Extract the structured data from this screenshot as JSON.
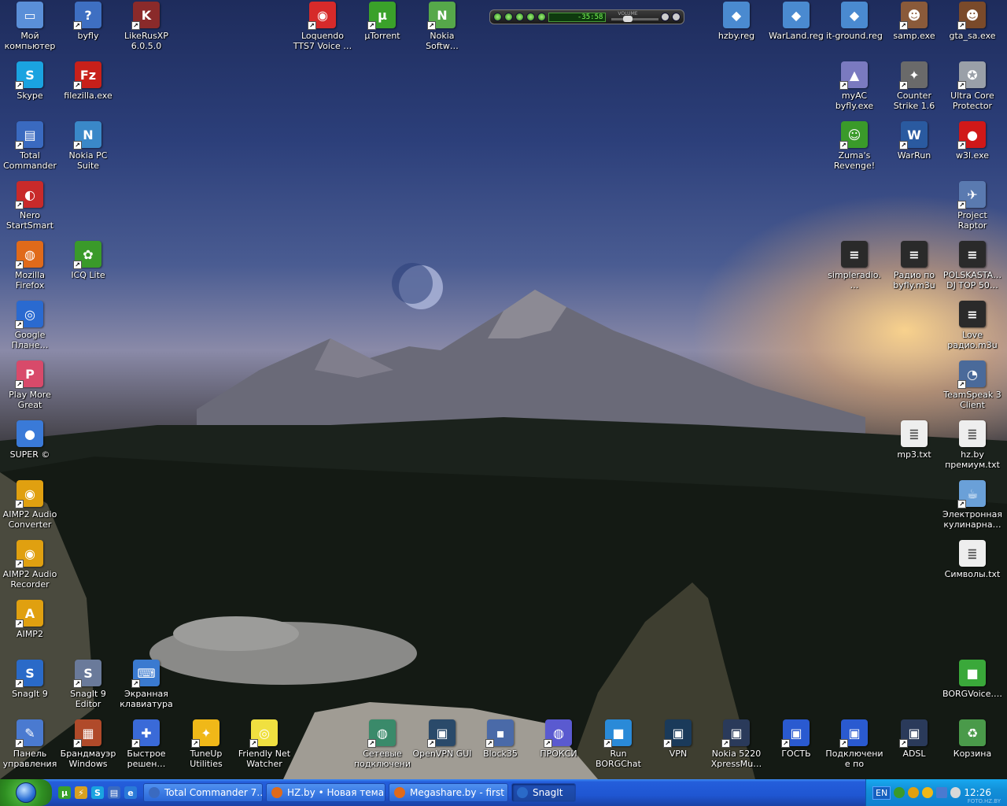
{
  "desktop_icons": [
    {
      "name": "my-computer-icon",
      "label": "Мой компьютер",
      "glyph": "▭",
      "color": "#5a8fd8",
      "shortcut": false
    },
    {
      "name": "byfly-icon",
      "label": "byfly",
      "glyph": "?",
      "color": "#3e6fc2",
      "shortcut": true
    },
    {
      "name": "likerusxp-icon",
      "label": "LikeRusXP 6.0.5.0",
      "glyph": "K",
      "color": "#8a2a2a",
      "shortcut": true
    },
    {
      "name": "loquendo-icon",
      "label": "Loquendo TTS7 Voice …",
      "glyph": "◉",
      "color": "#d62a2a",
      "shortcut": true
    },
    {
      "name": "utorrent-icon",
      "label": "µTorrent",
      "glyph": "µ",
      "color": "#3aa12a",
      "shortcut": true
    },
    {
      "name": "nokia-software-icon",
      "label": "Nokia Softw…",
      "glyph": "N",
      "color": "#56a84a",
      "shortcut": true
    },
    {
      "name": "hzby-reg-icon",
      "label": "hzby.reg",
      "glyph": "◆",
      "color": "#4a8ad0",
      "shortcut": false
    },
    {
      "name": "warland-reg-icon",
      "label": "WarLand.reg",
      "glyph": "◆",
      "color": "#4a8ad0",
      "shortcut": false
    },
    {
      "name": "it-ground-reg-icon",
      "label": "it-ground.reg",
      "glyph": "◆",
      "color": "#4a8ad0",
      "shortcut": false
    },
    {
      "name": "samp-icon",
      "label": "samp.exe",
      "glyph": "☻",
      "color": "#8a5a3a",
      "shortcut": true
    },
    {
      "name": "gta-sa-icon",
      "label": "gta_sa.exe",
      "glyph": "☻",
      "color": "#7a4a2a",
      "shortcut": true
    },
    {
      "name": "skype-icon",
      "label": "Skype",
      "glyph": "S",
      "color": "#1aa3e0",
      "shortcut": true
    },
    {
      "name": "filezilla-icon",
      "label": "filezilla.exe",
      "glyph": "Fz",
      "color": "#c8201a",
      "shortcut": true
    },
    {
      "name": "myac-icon",
      "label": "myAC byfly.exe",
      "glyph": "▲",
      "color": "#7a7ac0",
      "shortcut": true
    },
    {
      "name": "counter-strike-icon",
      "label": "Counter Strike 1.6",
      "glyph": "✦",
      "color": "#6a6a6a",
      "shortcut": true
    },
    {
      "name": "ultra-core-icon",
      "label": "Ultra Core Protector",
      "glyph": "✪",
      "color": "#9aa0a8",
      "shortcut": true
    },
    {
      "name": "total-commander-icon",
      "label": "Total Commander",
      "glyph": "▤",
      "color": "#3a6ac0",
      "shortcut": true
    },
    {
      "name": "nokia-pc-suite-icon",
      "label": "Nokia PC Suite",
      "glyph": "N",
      "color": "#3a88c8",
      "shortcut": true
    },
    {
      "name": "zuma-icon",
      "label": "Zuma's Revenge!",
      "glyph": "☺",
      "color": "#3a9a2a",
      "shortcut": true
    },
    {
      "name": "warrun-icon",
      "label": "WarRun",
      "glyph": "W",
      "color": "#2a5aa0",
      "shortcut": true
    },
    {
      "name": "w3l-icon",
      "label": "w3l.exe",
      "glyph": "●",
      "color": "#d01818",
      "shortcut": true
    },
    {
      "name": "nero-icon",
      "label": "Nero StartSmart",
      "glyph": "◐",
      "color": "#c82a2a",
      "shortcut": true
    },
    {
      "name": "project-raptor-icon",
      "label": "Project Raptor",
      "glyph": "✈",
      "color": "#5a7ab0",
      "shortcut": true
    },
    {
      "name": "firefox-icon",
      "label": "Mozilla Firefox",
      "glyph": "◍",
      "color": "#e06a1a",
      "shortcut": true
    },
    {
      "name": "icq-icon",
      "label": "ICQ Lite",
      "glyph": "✿",
      "color": "#3a9a2a",
      "shortcut": true
    },
    {
      "name": "simpleradio-icon",
      "label": "simpleradio.…",
      "glyph": "≡",
      "color": "#2a2a2a",
      "shortcut": false
    },
    {
      "name": "radio-byfly-icon",
      "label": "Радио по byfly.m3u",
      "glyph": "≡",
      "color": "#2a2a2a",
      "shortcut": false
    },
    {
      "name": "polskasta-icon",
      "label": "POLSKASTA… DJ TOP 50…",
      "glyph": "≡",
      "color": "#2a2a2a",
      "shortcut": false
    },
    {
      "name": "google-earth-icon",
      "label": "Google Плане…",
      "glyph": "◎",
      "color": "#2a6ad0",
      "shortcut": true
    },
    {
      "name": "love-radio-icon",
      "label": "Love радио.m3u",
      "glyph": "≡",
      "color": "#2a2a2a",
      "shortcut": false
    },
    {
      "name": "play-more-games-icon",
      "label": "Play More Great Games!",
      "glyph": "P",
      "color": "#d84a6a",
      "shortcut": true
    },
    {
      "name": "teamspeak-icon",
      "label": "TeamSpeak 3 Client",
      "glyph": "◔",
      "color": "#4a6a9a",
      "shortcut": true
    },
    {
      "name": "super-icon",
      "label": "SUPER ©",
      "glyph": "●",
      "color": "#3a7ad8",
      "shortcut": false
    },
    {
      "name": "mp3-txt-icon",
      "label": "mp3.txt",
      "glyph": "≣",
      "color": "#eeeeee",
      "shortcut": false
    },
    {
      "name": "hzby-premium-icon",
      "label": "hz.by премиум.txt",
      "glyph": "≣",
      "color": "#eeeeee",
      "shortcut": false
    },
    {
      "name": "aimp2-audio-converter-icon",
      "label": "AIMP2 Audio Converter",
      "glyph": "◉",
      "color": "#e0a010",
      "shortcut": true
    },
    {
      "name": "electronic-cookbook-icon",
      "label": "Электронная кулинарна…",
      "glyph": "☕",
      "color": "#6aa0d8",
      "shortcut": true
    },
    {
      "name": "aimp2-audio-recorder-icon",
      "label": "AIMP2 Audio Recorder",
      "glyph": "◉",
      "color": "#e0a010",
      "shortcut": true
    },
    {
      "name": "symbols-txt-icon",
      "label": "Символы.txt",
      "glyph": "≣",
      "color": "#eeeeee",
      "shortcut": false
    },
    {
      "name": "aimp2-icon",
      "label": "AIMP2",
      "glyph": "A",
      "color": "#e0a010",
      "shortcut": true
    },
    {
      "name": "snagit9-icon",
      "label": "SnagIt 9",
      "glyph": "S",
      "color": "#2a6ac8",
      "shortcut": true
    },
    {
      "name": "snagit9-editor-icon",
      "label": "SnagIt 9 Editor",
      "glyph": "S",
      "color": "#6a7a9a",
      "shortcut": true
    },
    {
      "name": "onscreen-keyboard-icon",
      "label": "Экранная клавиатура",
      "glyph": "⌨",
      "color": "#3a7ad0",
      "shortcut": true
    },
    {
      "name": "borgvoice-icon",
      "label": "BORGVoice.…",
      "glyph": "■",
      "color": "#3aa83a",
      "shortcut": false
    },
    {
      "name": "control-panel-icon",
      "label": "Панель управления",
      "glyph": "✎",
      "color": "#4a7ad0",
      "shortcut": true
    },
    {
      "name": "windows-firewall-icon",
      "label": "Брандмауэр Windows",
      "glyph": "▦",
      "color": "#b04a2a",
      "shortcut": true
    },
    {
      "name": "quick-solution-icon",
      "label": "Быстрое решен…",
      "glyph": "✚",
      "color": "#3a6ad8",
      "shortcut": true
    },
    {
      "name": "tuneup-icon",
      "label": "TuneUp Utilities",
      "glyph": "✦",
      "color": "#f0b818",
      "shortcut": true
    },
    {
      "name": "friendly-net-watcher-icon",
      "label": "Friendly Net Watcher",
      "glyph": "◎",
      "color": "#f0e040",
      "shortcut": true
    },
    {
      "name": "network-connections-icon",
      "label": "Сетевые подключения",
      "glyph": "◍",
      "color": "#3a8a6a",
      "shortcut": true
    },
    {
      "name": "openvpn-gui-icon",
      "label": "OpenVPN GUI",
      "glyph": "▣",
      "color": "#2a4a6a",
      "shortcut": true
    },
    {
      "name": "block35-icon",
      "label": "Block35",
      "glyph": "▪",
      "color": "#4a6aa8",
      "shortcut": true
    },
    {
      "name": "proxy-icon",
      "label": "ПРОКСИ",
      "glyph": "◍",
      "color": "#5a5ad0",
      "shortcut": true
    },
    {
      "name": "run-borgchat-icon",
      "label": "Run BORGChat",
      "glyph": "■",
      "color": "#2a8ad8",
      "shortcut": true
    },
    {
      "name": "vpn-icon",
      "label": "VPN",
      "glyph": "▣",
      "color": "#1a3a5a",
      "shortcut": true
    },
    {
      "name": "nokia-5220-icon",
      "label": "Nokia 5220 XpressMu…",
      "glyph": "▣",
      "color": "#2a3a5a",
      "shortcut": true
    },
    {
      "name": "guest-icon",
      "label": "ГОСТЬ",
      "glyph": "▣",
      "color": "#2a5ad0",
      "shortcut": true
    },
    {
      "name": "local-connection-icon",
      "label": "Подключение по локальн…",
      "glyph": "▣",
      "color": "#2a5ad0",
      "shortcut": true
    },
    {
      "name": "adsl-icon",
      "label": "ADSL",
      "glyph": "▣",
      "color": "#2a3a5a",
      "shortcut": true
    },
    {
      "name": "recycle-bin-icon",
      "label": "Корзина",
      "glyph": "♻",
      "color": "#4a9a4a",
      "shortcut": false
    }
  ],
  "media_player": {
    "time": "-35:58",
    "volume_label": "VOLUME",
    "volume": 0.3
  },
  "taskbar": {
    "quick_launch": [
      "utorrent-icon",
      "winamp-icon",
      "skype-icon",
      "total-commander-icon",
      "ie-icon"
    ],
    "buttons": [
      {
        "label": "Total Commander 7…",
        "icon_color": "#3a6ac0",
        "active": false
      },
      {
        "label": "HZ.by • Новая тема …",
        "icon_color": "#e06a1a",
        "active": false
      },
      {
        "label": "Megashare.by - first …",
        "icon_color": "#e06a1a",
        "active": false
      },
      {
        "label": "SnagIt",
        "icon_color": "#2a6ac8",
        "active": true
      }
    ],
    "tray": {
      "language": "EN",
      "time": "12:26",
      "watermark": "FOTO.HZ.BY"
    }
  },
  "colors": {
    "taskbar": "#245edb",
    "start": "#2f8f22",
    "tray": "#0f7fd0"
  }
}
